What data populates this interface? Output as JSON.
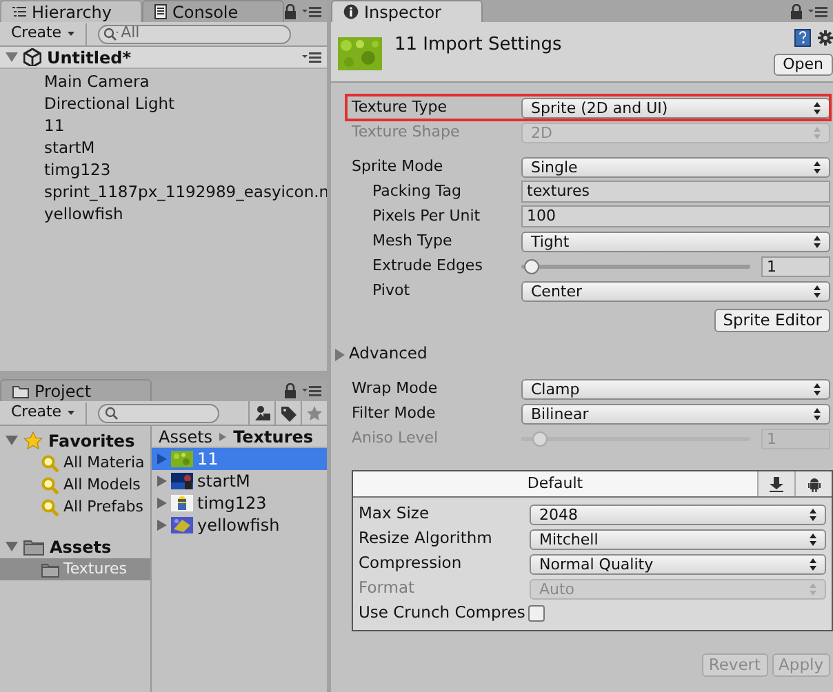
{
  "hierarchy": {
    "tabs": [
      {
        "label": "Hierarchy",
        "kind": "hierarchy",
        "selected": true
      },
      {
        "label": "Console",
        "kind": "console",
        "selected": false
      }
    ],
    "create": "Create",
    "search": {
      "placeholder": "All"
    },
    "scene": {
      "name": "Untitled*",
      "expanded": true
    },
    "items": [
      "Main Camera",
      "Directional Light",
      "11",
      "startM",
      "timg123",
      "sprint_1187px_1192989_easyicon.n",
      "yellowfish"
    ]
  },
  "project": {
    "tab": "Project",
    "create": "Create",
    "tree": [
      {
        "label": "Favorites",
        "kind": "favorites",
        "expanded": true,
        "children": [
          {
            "label": "All Materia",
            "selected": false
          },
          {
            "label": "All Models",
            "selected": false
          },
          {
            "label": "All Prefabs",
            "selected": false
          }
        ]
      },
      {
        "label": "Assets",
        "kind": "folder",
        "expanded": true,
        "children": [
          {
            "label": "Textures",
            "selected": true
          }
        ]
      }
    ],
    "breadcrumb": [
      "Assets",
      "Textures"
    ],
    "files": [
      {
        "name": "11",
        "selected": true
      },
      {
        "name": "startM",
        "selected": false
      },
      {
        "name": "timg123",
        "selected": false
      },
      {
        "name": "yellowfish",
        "selected": false
      }
    ]
  },
  "inspector": {
    "tab": "Inspector",
    "title": "11 Import Settings",
    "open_button": "Open",
    "fields": [
      {
        "kind": "dropdown",
        "label": "Texture Type",
        "value": "Sprite (2D and UI)",
        "disabled": false,
        "highlighted": true
      },
      {
        "kind": "dropdown",
        "label": "Texture Shape",
        "value": "2D",
        "disabled": true,
        "highlighted": false
      },
      {
        "kind": "gap"
      },
      {
        "kind": "dropdown",
        "label": "Sprite Mode",
        "value": "Single",
        "disabled": false,
        "highlighted": false,
        "children": [
          {
            "kind": "text",
            "label": "Packing Tag",
            "value": "textures",
            "disabled": false
          },
          {
            "kind": "text",
            "label": "Pixels Per Unit",
            "value": "100",
            "disabled": false
          },
          {
            "kind": "dropdown",
            "label": "Mesh Type",
            "value": "Tight",
            "disabled": false
          },
          {
            "kind": "slider",
            "label": "Extrude Edges",
            "value": "1",
            "level": 0.04,
            "disabled": false
          },
          {
            "kind": "dropdown",
            "label": "Pivot",
            "value": "Center",
            "disabled": false
          }
        ]
      },
      {
        "kind": "button",
        "label": "Sprite Editor"
      },
      {
        "kind": "foldout",
        "label": "Advanced",
        "expanded": false
      },
      {
        "kind": "dropdown",
        "label": "Wrap Mode",
        "value": "Clamp",
        "disabled": false,
        "highlighted": false
      },
      {
        "kind": "dropdown",
        "label": "Filter Mode",
        "value": "Bilinear",
        "disabled": false,
        "highlighted": false
      },
      {
        "kind": "slider",
        "label": "Aniso Level",
        "value": "1",
        "level": 0.08,
        "disabled": true
      }
    ],
    "platform": {
      "tabs": [
        {
          "kind": "default",
          "label": "Default",
          "selected": true
        },
        {
          "kind": "download",
          "selected": false
        },
        {
          "kind": "android",
          "selected": false
        }
      ],
      "fields": [
        {
          "kind": "dropdown",
          "label": "Max Size",
          "value": "2048",
          "disabled": false
        },
        {
          "kind": "dropdown",
          "label": "Resize Algorithm",
          "value": "Mitchell",
          "disabled": false
        },
        {
          "kind": "dropdown",
          "label": "Compression",
          "value": "Normal Quality",
          "disabled": false
        },
        {
          "kind": "dropdown",
          "label": "Format",
          "value": "Auto",
          "disabled": true
        },
        {
          "kind": "checkbox",
          "label": "Use Crunch Compres",
          "checked": false
        }
      ]
    },
    "buttons": [
      {
        "label": "Revert",
        "disabled": true
      },
      {
        "label": "Apply",
        "disabled": true
      }
    ]
  }
}
